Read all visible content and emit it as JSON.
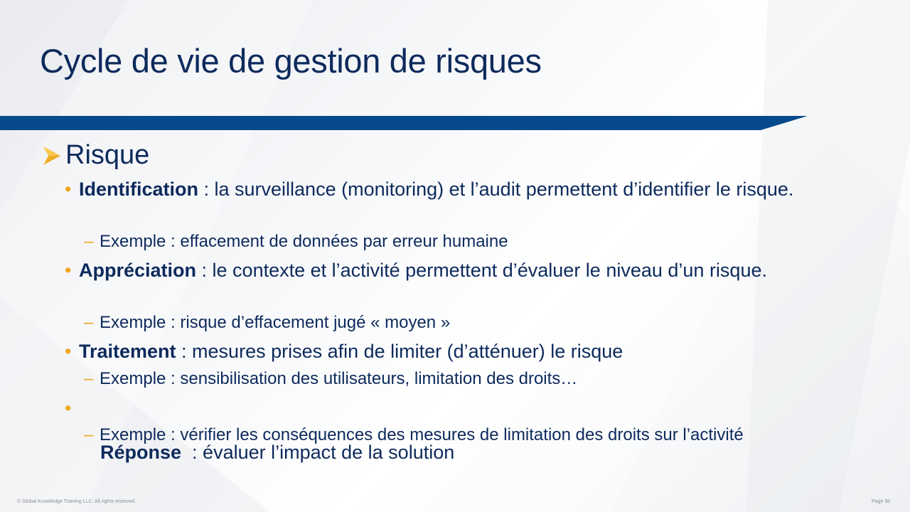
{
  "slide": {
    "title": "Cycle de vie de gestion de risques",
    "heading": "Risque",
    "items": [
      {
        "term": "Identification",
        "text": " : la surveillance (monitoring) et l’audit permettent d’identifier le risque.",
        "example": "Exemple : effacement de données par erreur humaine"
      },
      {
        "term": "Appréciation",
        "text": " : le contexte et l’activité permettent d’évaluer le niveau d’un risque.",
        "example": "Exemple : risque d’effacement jugé « moyen »"
      },
      {
        "term": "Traitement",
        "text": " : mesures prises afin de limiter (d’atténuer) le risque",
        "example": "Exemple : sensibilisation des utilisateurs, limitation des droits…"
      },
      {
        "term": "Réponse",
        "text": "  : évaluer l’impact de la solution",
        "example": "Exemple : vérifier les conséquences des mesures de limitation des droits sur l’activité"
      }
    ]
  },
  "footer": {
    "copyright": "© Global Knowledge  Training LLC. All rights reserved.",
    "page": "Page 36"
  },
  "colors": {
    "title": "#0d2a5c",
    "band": "#064a8c",
    "accent": "#f0a81c"
  }
}
